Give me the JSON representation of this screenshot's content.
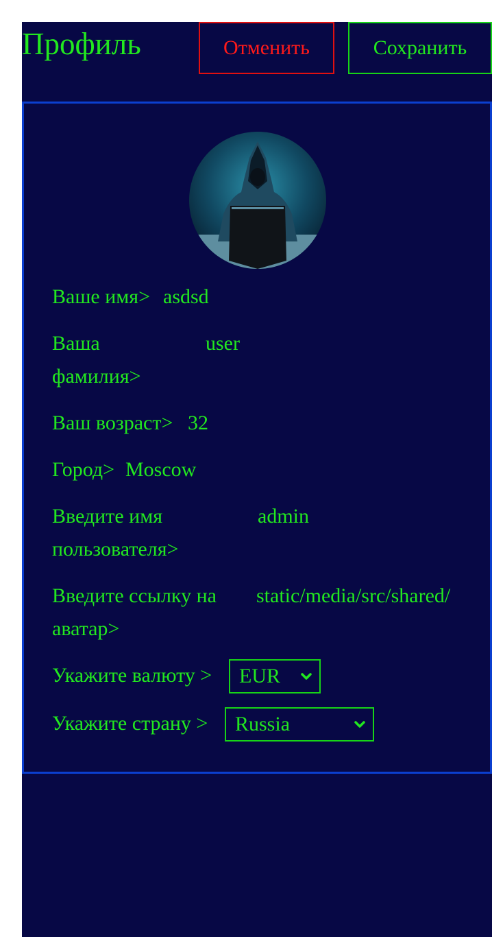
{
  "header": {
    "title": "Профиль",
    "cancel_label": "Отменить",
    "save_label": "Сохранить"
  },
  "avatar": {
    "icon": "hooded-hacker-avatar"
  },
  "fields": {
    "first_name": {
      "label": "Ваше имя>",
      "value": "asdsd"
    },
    "last_name": {
      "label_line1": "Ваша",
      "label_line2": "фамилия>",
      "value": "user"
    },
    "age": {
      "label": "Ваш возраст>",
      "value": "32"
    },
    "city": {
      "label": "Город>",
      "value": "Moscow"
    },
    "username": {
      "label_line1": "Введите имя",
      "label_line2": "пользователя>",
      "value": "admin"
    },
    "avatar_link": {
      "label_line1": "Введите ссылку на",
      "label_line2": "аватар>",
      "value": "static/media/src/shared/"
    },
    "currency": {
      "label": "Укажите валюту >",
      "selected": "EUR"
    },
    "country": {
      "label": "Укажите страну >",
      "selected": "Russia"
    }
  },
  "colors": {
    "background": "#070845",
    "text": "#22e81f",
    "cancel": "#ff1a1a",
    "card_border": "#0b3fcf"
  }
}
